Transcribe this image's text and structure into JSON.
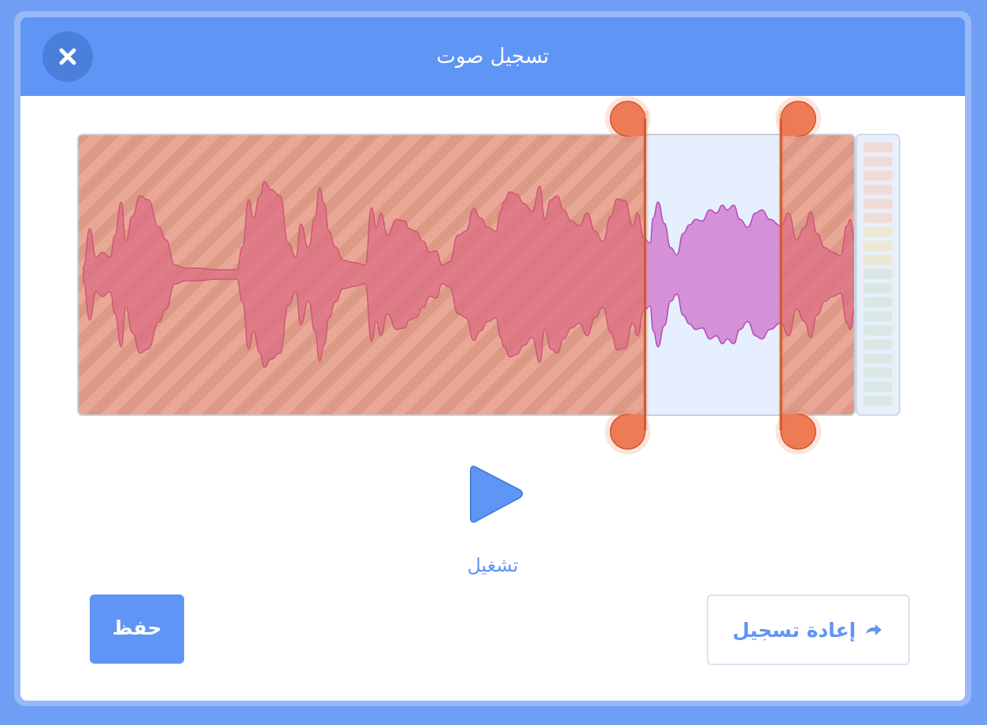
{
  "dialog": {
    "title": "تسجيل صوت",
    "close_icon": "close-icon"
  },
  "editor": {
    "trim_start": 0.73,
    "trim_end": 0.905,
    "colors": {
      "trimmed_fill": "#e9a896",
      "trimmed_stripe": "#dc9986",
      "trimmed_wave": "#dc6e83",
      "selected_fill": "#e5effd",
      "selected_wave": "#d591d8",
      "handle": "#ee7b55",
      "handle_border": "#cf5a2f",
      "accent": "#5f95f5"
    },
    "level_meter_segments": 19
  },
  "playback": {
    "play_icon": "play-icon",
    "play_label": "تشغيل"
  },
  "footer": {
    "save_label": "حفظ",
    "rerecord_label": "إعادة تسجيل",
    "rerecord_icon": "redo-arrow-icon"
  }
}
